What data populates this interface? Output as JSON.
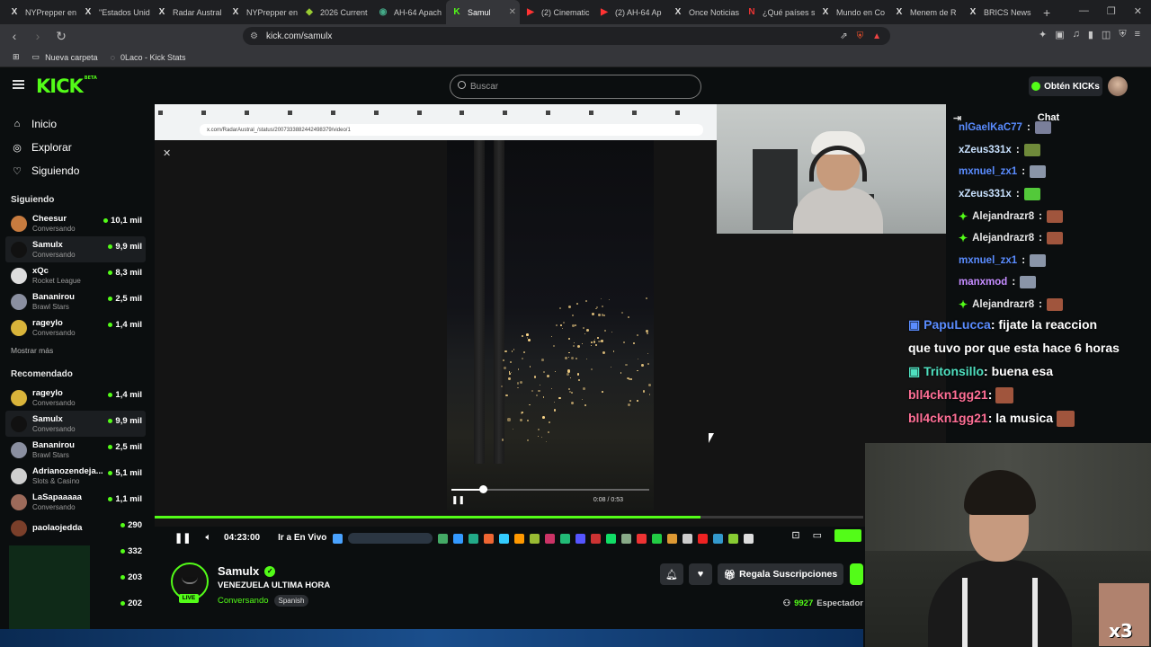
{
  "browser": {
    "tabs": [
      {
        "label": "NYPrepper en",
        "icon": "x-logo-icon"
      },
      {
        "label": "\"Estados Unid",
        "icon": "x-logo-icon"
      },
      {
        "label": "Radar Austral",
        "icon": "x-logo-icon"
      },
      {
        "label": "NYPrepper en",
        "icon": "x-logo-icon"
      },
      {
        "label": "2026 Current",
        "icon": "page-icon"
      },
      {
        "label": "AH-64 Apach",
        "icon": "globe-icon"
      },
      {
        "label": "Samul",
        "icon": "kick-icon",
        "active": true
      },
      {
        "label": "(2) Cinematic",
        "icon": "youtube-icon"
      },
      {
        "label": "(2) AH-64 Ap",
        "icon": "youtube-icon"
      },
      {
        "label": "Once Noticias",
        "icon": "x-logo-icon"
      },
      {
        "label": "¿Qué países s",
        "icon": "news-icon"
      },
      {
        "label": "Mundo en Co",
        "icon": "x-logo-icon"
      },
      {
        "label": "Menem de R",
        "icon": "x-logo-icon"
      },
      {
        "label": "BRICS News",
        "icon": "x-logo-icon"
      }
    ],
    "url": "kick.com/samulx",
    "bookmarks": [
      "Nueva carpeta",
      "0Laco - Kick Stats"
    ]
  },
  "header": {
    "search_placeholder": "Buscar",
    "kicks_label": "Obtén KICKs"
  },
  "sidebar": {
    "nav": [
      {
        "label": "Inicio",
        "icon": "home-icon"
      },
      {
        "label": "Explorar",
        "icon": "compass-icon"
      },
      {
        "label": "Siguiendo",
        "icon": "heart-icon"
      }
    ],
    "following_title": "Siguiendo",
    "following": [
      {
        "name": "Cheesur",
        "sub": "Conversando",
        "count": "10,1 mil",
        "color": "#c77b3f"
      },
      {
        "name": "Samulx",
        "sub": "Conversando",
        "count": "9,9 mil",
        "color": "#111111",
        "selected": true
      },
      {
        "name": "xQc",
        "sub": "Rocket League",
        "count": "8,3 mil",
        "color": "#dddddd"
      },
      {
        "name": "Bananirou",
        "sub": "Brawl Stars",
        "count": "2,5 mil",
        "color": "#8a8fa0"
      },
      {
        "name": "rageylo",
        "sub": "Conversando",
        "count": "1,4 mil",
        "color": "#d9b43a"
      }
    ],
    "show_more": "Mostrar más",
    "recommended_title": "Recomendado",
    "recommended": [
      {
        "name": "rageylo",
        "sub": "Conversando",
        "count": "1,4 mil",
        "color": "#d9b43a"
      },
      {
        "name": "Samulx",
        "sub": "Conversando",
        "count": "9,9 mil",
        "color": "#111111",
        "selected": true
      },
      {
        "name": "Bananirou",
        "sub": "Brawl Stars",
        "count": "2,5 mil",
        "color": "#8a8fa0"
      },
      {
        "name": "Adrianozendeja...",
        "sub": "Slots & Casino",
        "count": "5,1 mil",
        "color": "#cfcfcf"
      },
      {
        "name": "LaSapaaaaa",
        "sub": "Conversando",
        "count": "1,1 mil",
        "color": "#9c6a5a"
      },
      {
        "name": "paolaojedda",
        "sub": "",
        "count": "290",
        "color": "#7a3f2a"
      },
      {
        "name": "",
        "sub": "",
        "count": "332",
        "color": "#0b0e0f"
      },
      {
        "name": "",
        "sub": "",
        "count": "203",
        "color": "#0b0e0f"
      },
      {
        "name": "",
        "sub": "",
        "count": "202",
        "color": "#0b0e0f"
      }
    ]
  },
  "video": {
    "inner_url": "x.com/RadarAustral_/status/2007333882442498379/video/1",
    "clip_time": "0:08 / 0:53",
    "progress_fraction": 0.77,
    "clip_progress_fraction": 0.18
  },
  "player": {
    "time": "04:23:00",
    "live_label": "Ir a En Vivo"
  },
  "stream": {
    "name": "Samulx",
    "title": "VENEZUELA ULTIMA HORA",
    "category": "Conversando",
    "tag": "Spanish",
    "live_badge": "LIVE",
    "subs_label": "Regala Suscripciones",
    "viewers": "9927",
    "viewers_label": "Espectador"
  },
  "chat": {
    "title": "Chat",
    "messages": [
      {
        "user": "nlGaelKaC77",
        "color": "#5a8cff",
        "badge": false,
        "emote": "#7a7f9a"
      },
      {
        "user": "xZeus331x",
        "color": "#c9e2ff",
        "badge": false,
        "emote": "#6f8a3a"
      },
      {
        "user": "mxnuel_zx1",
        "color": "#5a8cff",
        "badge": false,
        "emote": "#8a95a8"
      },
      {
        "user": "xZeus331x",
        "color": "#c9e2ff",
        "badge": false,
        "emote": "#53c93a"
      },
      {
        "user": "Alejandrazr8",
        "color": "#e6e6e6",
        "badge": true,
        "emote": "#a0553d"
      },
      {
        "user": "Alejandrazr8",
        "color": "#e6e6e6",
        "badge": true,
        "emote": "#a0553d"
      },
      {
        "user": "mxnuel_zx1",
        "color": "#5a8cff",
        "badge": false,
        "emote": "#8a95a8"
      },
      {
        "user": "manxmod",
        "color": "#c58cff",
        "badge": false,
        "emote": "#8a95a8"
      },
      {
        "user": "Alejandrazr8",
        "color": "#e6e6e6",
        "badge": true,
        "emote": "#a0553d"
      }
    ]
  },
  "overlay_chat": [
    {
      "user": "PapuLucca",
      "text": ": fijate la reaccion",
      "color": "#5a8cff",
      "icon": true
    },
    {
      "user": "",
      "text": "que tuvo por que esta hace 6 horas",
      "color": "#ffffff",
      "icon": false
    },
    {
      "user": "Tritonsillo",
      "text": ": buena esa",
      "color": "#4fe0c0",
      "icon": true
    },
    {
      "user": "bll4ckn1gg21",
      "text": ":",
      "color": "#ff6f96",
      "icon": false
    },
    {
      "user": "bll4ckn1gg21",
      "text": ": la musica",
      "color": "#ff6f96",
      "icon": false
    }
  ],
  "overlay_x3": "x3",
  "colors": {
    "accent": "#53fc18",
    "background": "#0b0e0f"
  }
}
